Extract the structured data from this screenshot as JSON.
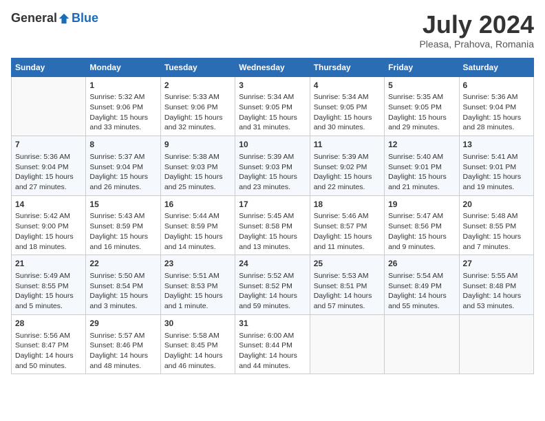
{
  "header": {
    "logo_general": "General",
    "logo_blue": "Blue",
    "title": "July 2024",
    "subtitle": "Pleasa, Prahova, Romania"
  },
  "days_of_week": [
    "Sunday",
    "Monday",
    "Tuesday",
    "Wednesday",
    "Thursday",
    "Friday",
    "Saturday"
  ],
  "weeks": [
    [
      {
        "day": "",
        "info": ""
      },
      {
        "day": "1",
        "info": "Sunrise: 5:32 AM\nSunset: 9:06 PM\nDaylight: 15 hours\nand 33 minutes."
      },
      {
        "day": "2",
        "info": "Sunrise: 5:33 AM\nSunset: 9:06 PM\nDaylight: 15 hours\nand 32 minutes."
      },
      {
        "day": "3",
        "info": "Sunrise: 5:34 AM\nSunset: 9:05 PM\nDaylight: 15 hours\nand 31 minutes."
      },
      {
        "day": "4",
        "info": "Sunrise: 5:34 AM\nSunset: 9:05 PM\nDaylight: 15 hours\nand 30 minutes."
      },
      {
        "day": "5",
        "info": "Sunrise: 5:35 AM\nSunset: 9:05 PM\nDaylight: 15 hours\nand 29 minutes."
      },
      {
        "day": "6",
        "info": "Sunrise: 5:36 AM\nSunset: 9:04 PM\nDaylight: 15 hours\nand 28 minutes."
      }
    ],
    [
      {
        "day": "7",
        "info": "Sunrise: 5:36 AM\nSunset: 9:04 PM\nDaylight: 15 hours\nand 27 minutes."
      },
      {
        "day": "8",
        "info": "Sunrise: 5:37 AM\nSunset: 9:04 PM\nDaylight: 15 hours\nand 26 minutes."
      },
      {
        "day": "9",
        "info": "Sunrise: 5:38 AM\nSunset: 9:03 PM\nDaylight: 15 hours\nand 25 minutes."
      },
      {
        "day": "10",
        "info": "Sunrise: 5:39 AM\nSunset: 9:03 PM\nDaylight: 15 hours\nand 23 minutes."
      },
      {
        "day": "11",
        "info": "Sunrise: 5:39 AM\nSunset: 9:02 PM\nDaylight: 15 hours\nand 22 minutes."
      },
      {
        "day": "12",
        "info": "Sunrise: 5:40 AM\nSunset: 9:01 PM\nDaylight: 15 hours\nand 21 minutes."
      },
      {
        "day": "13",
        "info": "Sunrise: 5:41 AM\nSunset: 9:01 PM\nDaylight: 15 hours\nand 19 minutes."
      }
    ],
    [
      {
        "day": "14",
        "info": "Sunrise: 5:42 AM\nSunset: 9:00 PM\nDaylight: 15 hours\nand 18 minutes."
      },
      {
        "day": "15",
        "info": "Sunrise: 5:43 AM\nSunset: 8:59 PM\nDaylight: 15 hours\nand 16 minutes."
      },
      {
        "day": "16",
        "info": "Sunrise: 5:44 AM\nSunset: 8:59 PM\nDaylight: 15 hours\nand 14 minutes."
      },
      {
        "day": "17",
        "info": "Sunrise: 5:45 AM\nSunset: 8:58 PM\nDaylight: 15 hours\nand 13 minutes."
      },
      {
        "day": "18",
        "info": "Sunrise: 5:46 AM\nSunset: 8:57 PM\nDaylight: 15 hours\nand 11 minutes."
      },
      {
        "day": "19",
        "info": "Sunrise: 5:47 AM\nSunset: 8:56 PM\nDaylight: 15 hours\nand 9 minutes."
      },
      {
        "day": "20",
        "info": "Sunrise: 5:48 AM\nSunset: 8:55 PM\nDaylight: 15 hours\nand 7 minutes."
      }
    ],
    [
      {
        "day": "21",
        "info": "Sunrise: 5:49 AM\nSunset: 8:55 PM\nDaylight: 15 hours\nand 5 minutes."
      },
      {
        "day": "22",
        "info": "Sunrise: 5:50 AM\nSunset: 8:54 PM\nDaylight: 15 hours\nand 3 minutes."
      },
      {
        "day": "23",
        "info": "Sunrise: 5:51 AM\nSunset: 8:53 PM\nDaylight: 15 hours\nand 1 minute."
      },
      {
        "day": "24",
        "info": "Sunrise: 5:52 AM\nSunset: 8:52 PM\nDaylight: 14 hours\nand 59 minutes."
      },
      {
        "day": "25",
        "info": "Sunrise: 5:53 AM\nSunset: 8:51 PM\nDaylight: 14 hours\nand 57 minutes."
      },
      {
        "day": "26",
        "info": "Sunrise: 5:54 AM\nSunset: 8:49 PM\nDaylight: 14 hours\nand 55 minutes."
      },
      {
        "day": "27",
        "info": "Sunrise: 5:55 AM\nSunset: 8:48 PM\nDaylight: 14 hours\nand 53 minutes."
      }
    ],
    [
      {
        "day": "28",
        "info": "Sunrise: 5:56 AM\nSunset: 8:47 PM\nDaylight: 14 hours\nand 50 minutes."
      },
      {
        "day": "29",
        "info": "Sunrise: 5:57 AM\nSunset: 8:46 PM\nDaylight: 14 hours\nand 48 minutes."
      },
      {
        "day": "30",
        "info": "Sunrise: 5:58 AM\nSunset: 8:45 PM\nDaylight: 14 hours\nand 46 minutes."
      },
      {
        "day": "31",
        "info": "Sunrise: 6:00 AM\nSunset: 8:44 PM\nDaylight: 14 hours\nand 44 minutes."
      },
      {
        "day": "",
        "info": ""
      },
      {
        "day": "",
        "info": ""
      },
      {
        "day": "",
        "info": ""
      }
    ]
  ]
}
